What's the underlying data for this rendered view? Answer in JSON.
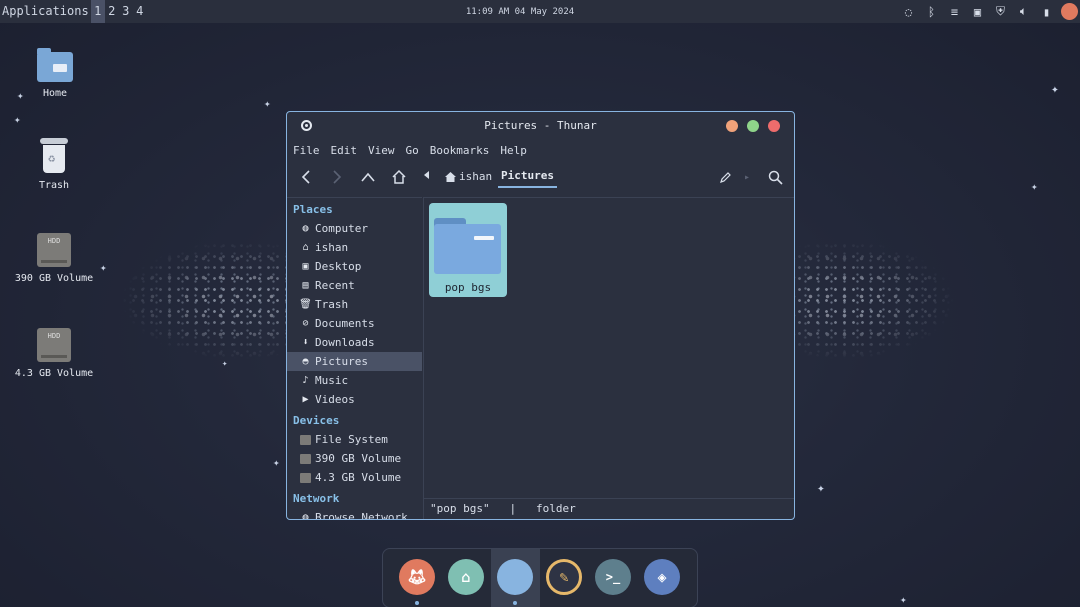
{
  "panel": {
    "applications_label": "Applications",
    "workspaces": [
      "1",
      "2",
      "3",
      "4"
    ],
    "active_workspace": "1",
    "clock": "11:09 AM 04 May 2024",
    "tray_icons": [
      "chat-icon",
      "bluetooth-icon",
      "network-icon",
      "clipboard-icon",
      "shield-icon",
      "volume-icon",
      "battery-icon",
      "user-avatar-icon"
    ]
  },
  "desktop": {
    "icons": [
      {
        "label": "Home",
        "icon": "home-folder-icon"
      },
      {
        "label": "Trash",
        "icon": "trash-icon"
      },
      {
        "label": "390 GB Volume",
        "icon": "hdd-icon"
      },
      {
        "label": "4.3 GB Volume",
        "icon": "hdd-icon"
      }
    ],
    "hdd_badge": "HDD"
  },
  "window": {
    "title": "Pictures - Thunar",
    "menu": [
      "File",
      "Edit",
      "View",
      "Go",
      "Bookmarks",
      "Help"
    ],
    "breadcrumb": {
      "home": "ishan",
      "current": "Pictures"
    },
    "sidebar": {
      "places_label": "Places",
      "places": [
        {
          "label": "Computer",
          "icon": "computer-icon"
        },
        {
          "label": "ishan",
          "icon": "home-icon"
        },
        {
          "label": "Desktop",
          "icon": "desktop-icon"
        },
        {
          "label": "Recent",
          "icon": "recent-icon"
        },
        {
          "label": "Trash",
          "icon": "trash-icon"
        },
        {
          "label": "Documents",
          "icon": "documents-icon"
        },
        {
          "label": "Downloads",
          "icon": "downloads-icon"
        },
        {
          "label": "Pictures",
          "icon": "pictures-icon",
          "selected": true
        },
        {
          "label": "Music",
          "icon": "music-icon"
        },
        {
          "label": "Videos",
          "icon": "videos-icon"
        }
      ],
      "devices_label": "Devices",
      "devices": [
        {
          "label": "File System",
          "icon": "hdd-icon"
        },
        {
          "label": "390 GB Volume",
          "icon": "hdd-icon"
        },
        {
          "label": "4.3 GB Volume",
          "icon": "hdd-icon"
        }
      ],
      "network_label": "Network",
      "network": [
        {
          "label": "Browse Network",
          "icon": "network-icon"
        }
      ]
    },
    "files": [
      {
        "name": "pop bgs",
        "type": "folder",
        "selected": true
      }
    ],
    "status": "\"pop bgs\"   |   folder"
  },
  "dock": {
    "items": [
      {
        "name": "firefox",
        "icon": "fox-icon",
        "color": "#e07a5f"
      },
      {
        "name": "store",
        "icon": "store-icon",
        "color": "#7fbfb2"
      },
      {
        "name": "files",
        "icon": "folder-icon",
        "color": "#88b4e0",
        "active": true
      },
      {
        "name": "text-editor",
        "icon": "pencil-icon",
        "color": "#e6b86a"
      },
      {
        "name": "terminal",
        "icon": "terminal-icon",
        "color": "#5e7f8d"
      },
      {
        "name": "settings",
        "icon": "settings-icon",
        "color": "#5e7fbf"
      }
    ]
  },
  "colors": {
    "accent": "#88b4e0",
    "section": "#88c0e8",
    "selection": "#8fcfd6",
    "close": "#ee6c6c",
    "maximize": "#8fd48a",
    "minimize": "#f0a27a"
  }
}
